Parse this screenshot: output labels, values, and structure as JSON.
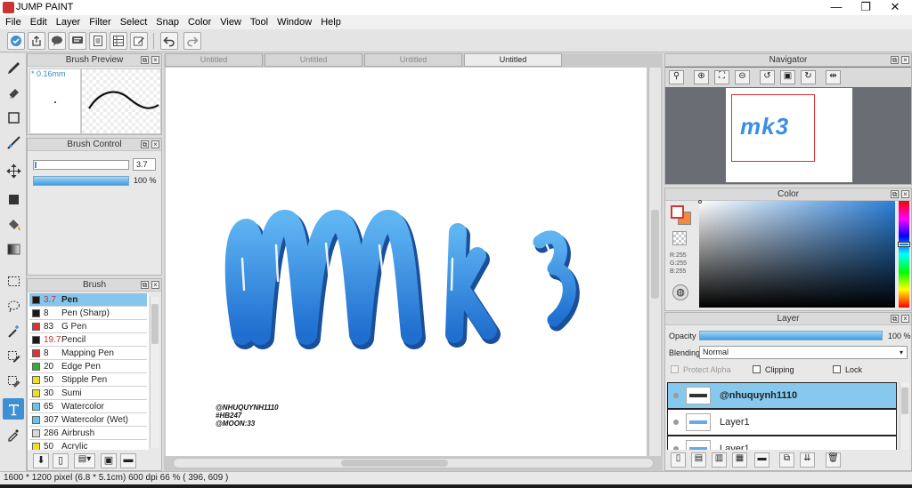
{
  "window": {
    "title": "JUMP PAINT",
    "minimize": "—",
    "maximize": "❐",
    "close": "✕"
  },
  "menu": [
    "File",
    "Edit",
    "Layer",
    "Filter",
    "Select",
    "Snap",
    "Color",
    "View",
    "Tool",
    "Window",
    "Help"
  ],
  "toolbar": {
    "icons": [
      "community-icon",
      "upload-icon",
      "comment-icon",
      "chat-icon",
      "page-icon",
      "grid-icon",
      "edit-icon"
    ],
    "undo_icon": "undo-icon",
    "redo_icon": "redo-icon"
  },
  "tools": [
    "brush-tool",
    "eraser-tool",
    "rect-tool",
    "line-tool",
    "move-tool",
    "fill-rect-tool",
    "bucket-tool",
    "gradient-tool",
    "select-rect-tool",
    "lasso-tool",
    "magic-wand-tool",
    "select-pen-tool",
    "select-eraser-tool",
    "text-tool",
    "eyedropper-tool"
  ],
  "brush_preview": {
    "title": "Brush Preview",
    "size_label": "* 0.16mm"
  },
  "brush_control": {
    "title": "Brush Control",
    "size_value": "3.7",
    "opacity_value": "100 %"
  },
  "brush_panel": {
    "title": "Brush",
    "items": [
      {
        "size": "3.7",
        "name": "Pen",
        "color": "#1a1a1a",
        "selected": true,
        "size_color": "#d03030"
      },
      {
        "size": "8",
        "name": "Pen (Sharp)",
        "color": "#1a1a1a"
      },
      {
        "size": "83",
        "name": "G Pen",
        "color": "#e03030"
      },
      {
        "size": "19.7",
        "name": "Pencil",
        "color": "#1a1a1a",
        "size_color": "#d03030"
      },
      {
        "size": "8",
        "name": "Mapping Pen",
        "color": "#e03030"
      },
      {
        "size": "20",
        "name": "Edge Pen",
        "color": "#30b030"
      },
      {
        "size": "50",
        "name": "Stipple Pen",
        "color": "#f0e020"
      },
      {
        "size": "30",
        "name": "Sumi",
        "color": "#f0e020"
      },
      {
        "size": "65",
        "name": "Watercolor",
        "color": "#60c8f0"
      },
      {
        "size": "307",
        "name": "Watercolor (Wet)",
        "color": "#60c8f0"
      },
      {
        "size": "286",
        "name": "Airbrush",
        "color": "#d8d8d8"
      },
      {
        "size": "50",
        "name": "Acrylic",
        "color": "#f0e020"
      }
    ]
  },
  "doc_tabs": [
    {
      "label": "Untitled",
      "active": false
    },
    {
      "label": "Untitled",
      "active": false
    },
    {
      "label": "Untitled",
      "active": false
    },
    {
      "label": "Untitled",
      "active": true
    }
  ],
  "canvas": {
    "artwork_text": "mk3",
    "credits": [
      "@NHUQUYNH1110",
      "#HB247",
      "@MOON:33"
    ]
  },
  "navigator": {
    "title": "Navigator",
    "thumb_text": "mk3"
  },
  "color_panel": {
    "title": "Color",
    "r": "R:255",
    "g": "G:255",
    "b": "B:255"
  },
  "layer_panel": {
    "title": "Layer",
    "opacity_label": "Opacity",
    "opacity_value": "100 %",
    "blending_label": "Blending",
    "blending_value": "Normal",
    "protect_alpha": "Protect Alpha",
    "clipping": "Clipping",
    "lock": "Lock",
    "layers": [
      {
        "name": "@nhuquynh1110",
        "selected": true
      },
      {
        "name": "Layer1",
        "selected": false
      },
      {
        "name": "Layer1",
        "selected": false
      }
    ]
  },
  "status": {
    "text": "1600 * 1200 pixel  (6.8 * 5.1cm)  600 dpi  66 %  ( 396, 609 )"
  },
  "colors": {
    "accent": "#3f8fd4",
    "selection": "#86c5ec",
    "artwork": "#3a8fe0"
  }
}
